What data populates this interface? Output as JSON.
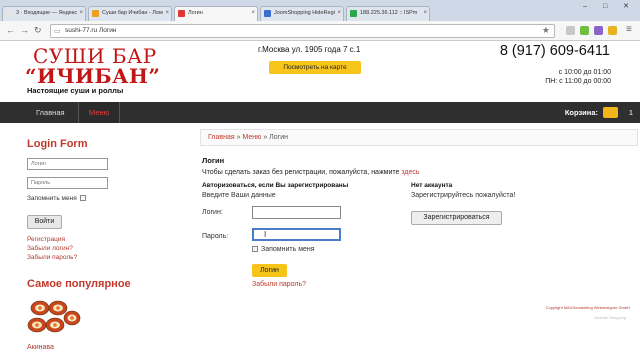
{
  "browser": {
    "tabs": [
      {
        "title": "3 · Входящие — Яндекс",
        "color": "#e5e5e5"
      },
      {
        "title": "Суши бар Ичибан - Лом",
        "color": "#f0a020"
      },
      {
        "title": "Логин",
        "color": "#e23636"
      },
      {
        "title": "JoomShopping HideRegi",
        "color": "#3a6fd0"
      },
      {
        "title": "188.225.36.112 :: ISPm",
        "color": "#2aa84a"
      }
    ],
    "window_controls": "– □ ✕",
    "url": "sushi-77.ru   Логин"
  },
  "header": {
    "logo_line1": "СУШИ БАР",
    "logo_line2": "“ИЧИБАН”",
    "tagline": "Настоящие суши и роллы",
    "address": "г.Москва ул. 1905 года 7 с.1",
    "map_button": "Посмотреть на карте",
    "phone": "8 (917) 609-6411",
    "hours1": "с 10:00 до 01:00",
    "hours2": "ПН: с 11:00 до 00:00"
  },
  "menu": {
    "items": [
      "Главная",
      "Меню"
    ],
    "cart_label": "Корзина:",
    "cart_count": "1"
  },
  "sidebar": {
    "title": "Login Form",
    "login_placeholder": "Логин",
    "password_placeholder": "Пароль",
    "remember": "Запомнить меня",
    "button": "Войти",
    "links": [
      "Регистрация",
      "Забыли логин?",
      "Забыли пароль?"
    ],
    "popular_title": "Самое популярное",
    "product_name": "Акинава"
  },
  "main": {
    "breadcrumb": {
      "home": "Главная",
      "sep": " » ",
      "menu": "Меню",
      "current": "Логин"
    },
    "heading": "Логин",
    "intro_text": "Чтобы сделать заказ без регистрации, пожалуйста, нажмите ",
    "intro_link": "здесь",
    "left_heading": "Авторизоваться, если Вы зарегистрированы",
    "left_sub": "Введите Ваши данные",
    "login_label": "Логин:",
    "password_label": "Пароль:",
    "remember": "Запомнить меня",
    "login_button": "Логин",
    "forgot": "Забыли пароль?",
    "right_heading": "Нет аккаунта",
    "right_sub": "Зарегистрируйтесь пожалуйста!",
    "register_button": "Зарегистрироваться"
  },
  "footer": {
    "copyright": "Copyright MAXXmarketing Webdesigner GmbH",
    "line2": "Joomla! Shopping"
  },
  "colors": {
    "accent": "#c0392b",
    "button_yellow": "#f7c41a",
    "menubar": "#2f2f2f"
  }
}
